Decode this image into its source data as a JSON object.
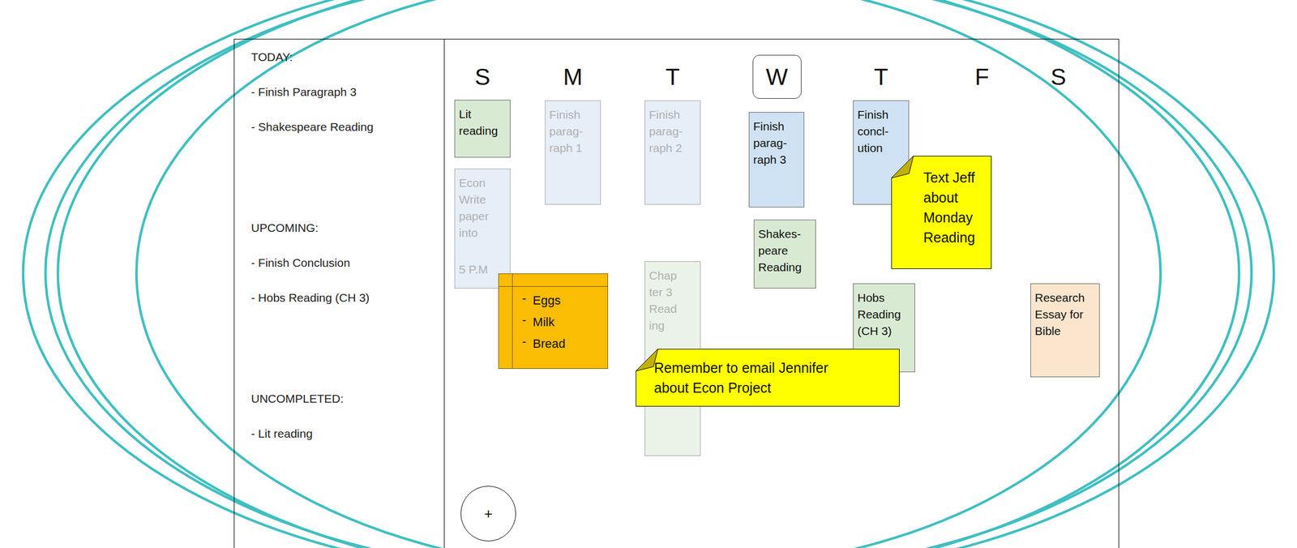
{
  "sidebar": {
    "sections": [
      {
        "heading": "TODAY:",
        "items": [
          "- Finish Paragraph 3",
          "- Shakespeare Reading"
        ]
      },
      {
        "heading": "UPCOMING:",
        "items": [
          "- Finish Conclusion",
          "- Hobs Reading (CH 3)"
        ]
      },
      {
        "heading": "UNCOMPLETED:",
        "items": [
          "- Lit reading"
        ]
      }
    ]
  },
  "calendar": {
    "days": [
      {
        "label": "S",
        "selected": false,
        "entries": [
          {
            "lines": [
              "Lit",
              "reading"
            ],
            "completed": false,
            "color": "#d9ead3"
          },
          {
            "lines": [
              "Econ",
              "Write",
              "paper",
              "into"
            ],
            "time": "5 P.M",
            "completed": true,
            "color": "#e6eef8"
          }
        ]
      },
      {
        "label": "M",
        "selected": false,
        "entries": [
          {
            "lines": [
              "Finish",
              "parag-",
              "raph 1"
            ],
            "completed": true,
            "color": "#e6eef8"
          }
        ]
      },
      {
        "label": "T",
        "selected": false,
        "entries": [
          {
            "lines": [
              "Finish",
              "parag-",
              "raph 2"
            ],
            "completed": true,
            "color": "#e6eef8"
          },
          {
            "lines": [
              "Chap",
              "ter 3",
              "Read",
              "ing"
            ],
            "completed": true,
            "color": "#ebf3e8"
          }
        ]
      },
      {
        "label": "W",
        "selected": true,
        "entries": [
          {
            "lines": [
              "Finish",
              "parag-",
              "raph 3"
            ],
            "completed": false,
            "color": "#cfe2f3"
          },
          {
            "lines": [
              "Shakes-",
              "peare",
              "Reading"
            ],
            "completed": false,
            "color": "#d9ead3"
          }
        ]
      },
      {
        "label": "T",
        "selected": false,
        "entries": [
          {
            "lines": [
              "Finish",
              "concl-",
              "ution"
            ],
            "completed": false,
            "color": "#cfe2f3"
          },
          {
            "lines": [
              "Hobs",
              "Reading",
              "(CH 3)"
            ],
            "completed": false,
            "color": "#d9ead3"
          }
        ]
      },
      {
        "label": "F",
        "selected": false,
        "entries": []
      },
      {
        "label": "S",
        "selected": false,
        "entries": [
          {
            "lines": [
              "Research",
              "Essay for",
              "Bible"
            ],
            "completed": false,
            "color": "#fce5cd"
          }
        ]
      }
    ]
  },
  "notes": [
    {
      "kind": "checklist",
      "color": "#fbbc04",
      "bullet": "-",
      "items": [
        "Eggs",
        "Milk",
        "Bread"
      ]
    },
    {
      "kind": "sticky",
      "color": "#ffff00",
      "lines": [
        "Text Jeff",
        "about",
        "Monday",
        "Reading"
      ]
    },
    {
      "kind": "sticky",
      "color": "#ffff00",
      "lines": [
        "Remember to email Jennifer",
        "about Econ Project"
      ]
    }
  ],
  "add_button": {
    "label": "+"
  }
}
